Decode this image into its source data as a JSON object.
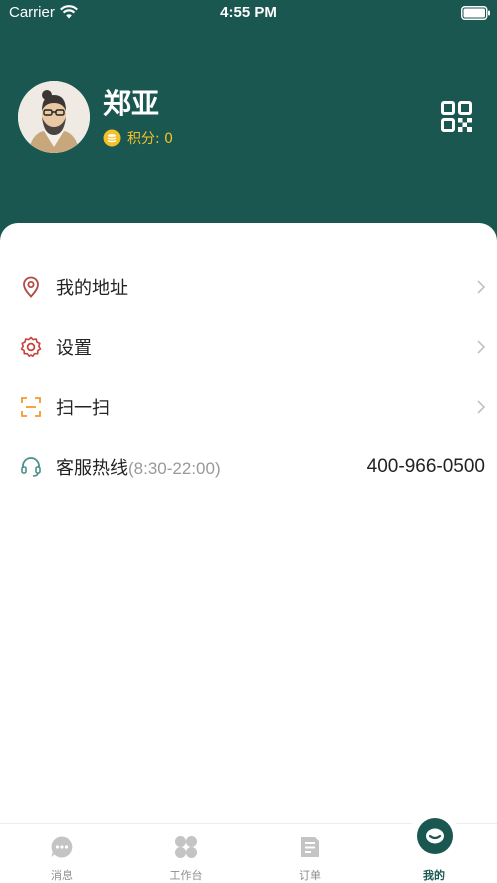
{
  "status_bar": {
    "carrier": "Carrier",
    "time": "4:55 PM"
  },
  "profile": {
    "name": "郑亚",
    "points_label": "积分: 0"
  },
  "menu": [
    {
      "label": "我的地址",
      "icon": "location-pin-icon",
      "color": "#b34a45"
    },
    {
      "label": "设置",
      "icon": "gear-icon",
      "color": "#c8403b"
    },
    {
      "label": "扫一扫",
      "icon": "scan-icon",
      "color": "#f29a2e"
    }
  ],
  "hotline": {
    "label": "客服热线",
    "hours": "(8:30-22:00)",
    "number": "400-966-0500",
    "icon": "headset-icon",
    "color": "#4b8f8a"
  },
  "tabs": [
    {
      "label": "消息",
      "icon": "chat-bubble-icon"
    },
    {
      "label": "工作台",
      "icon": "grid-icon"
    },
    {
      "label": "订单",
      "icon": "document-icon"
    },
    {
      "label": "我的",
      "icon": "profile-face-icon",
      "active": true
    }
  ],
  "colors": {
    "header": "#1b5751",
    "points": "#f5c02a",
    "inactive_tab": "#c4c4c4"
  }
}
